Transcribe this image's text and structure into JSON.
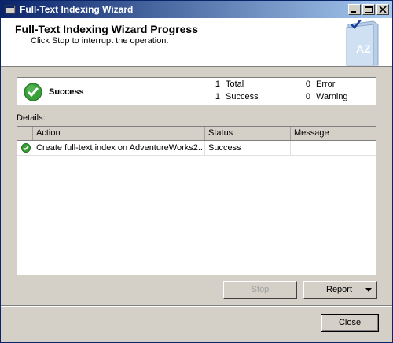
{
  "window": {
    "title": "Full-Text Indexing Wizard"
  },
  "header": {
    "title": "Full-Text Indexing Wizard Progress",
    "subtitle": "Click Stop to interrupt the operation."
  },
  "summary": {
    "status": "Success",
    "total_count": "1",
    "total_label": "Total",
    "success_count": "1",
    "success_label": "Success",
    "error_count": "0",
    "error_label": "Error",
    "warning_count": "0",
    "warning_label": "Warning"
  },
  "details": {
    "label": "Details:",
    "columns": [
      "Action",
      "Status",
      "Message"
    ],
    "rows": [
      {
        "action": "Create full-text index on AdventureWorks2...",
        "status": "Success",
        "message": ""
      }
    ]
  },
  "buttons": {
    "stop": "Stop",
    "report": "Report",
    "close": "Close"
  },
  "colors": {
    "titlebar_start": "#0a246a",
    "titlebar_end": "#a6caf0",
    "success_green": "#3aa03a"
  }
}
